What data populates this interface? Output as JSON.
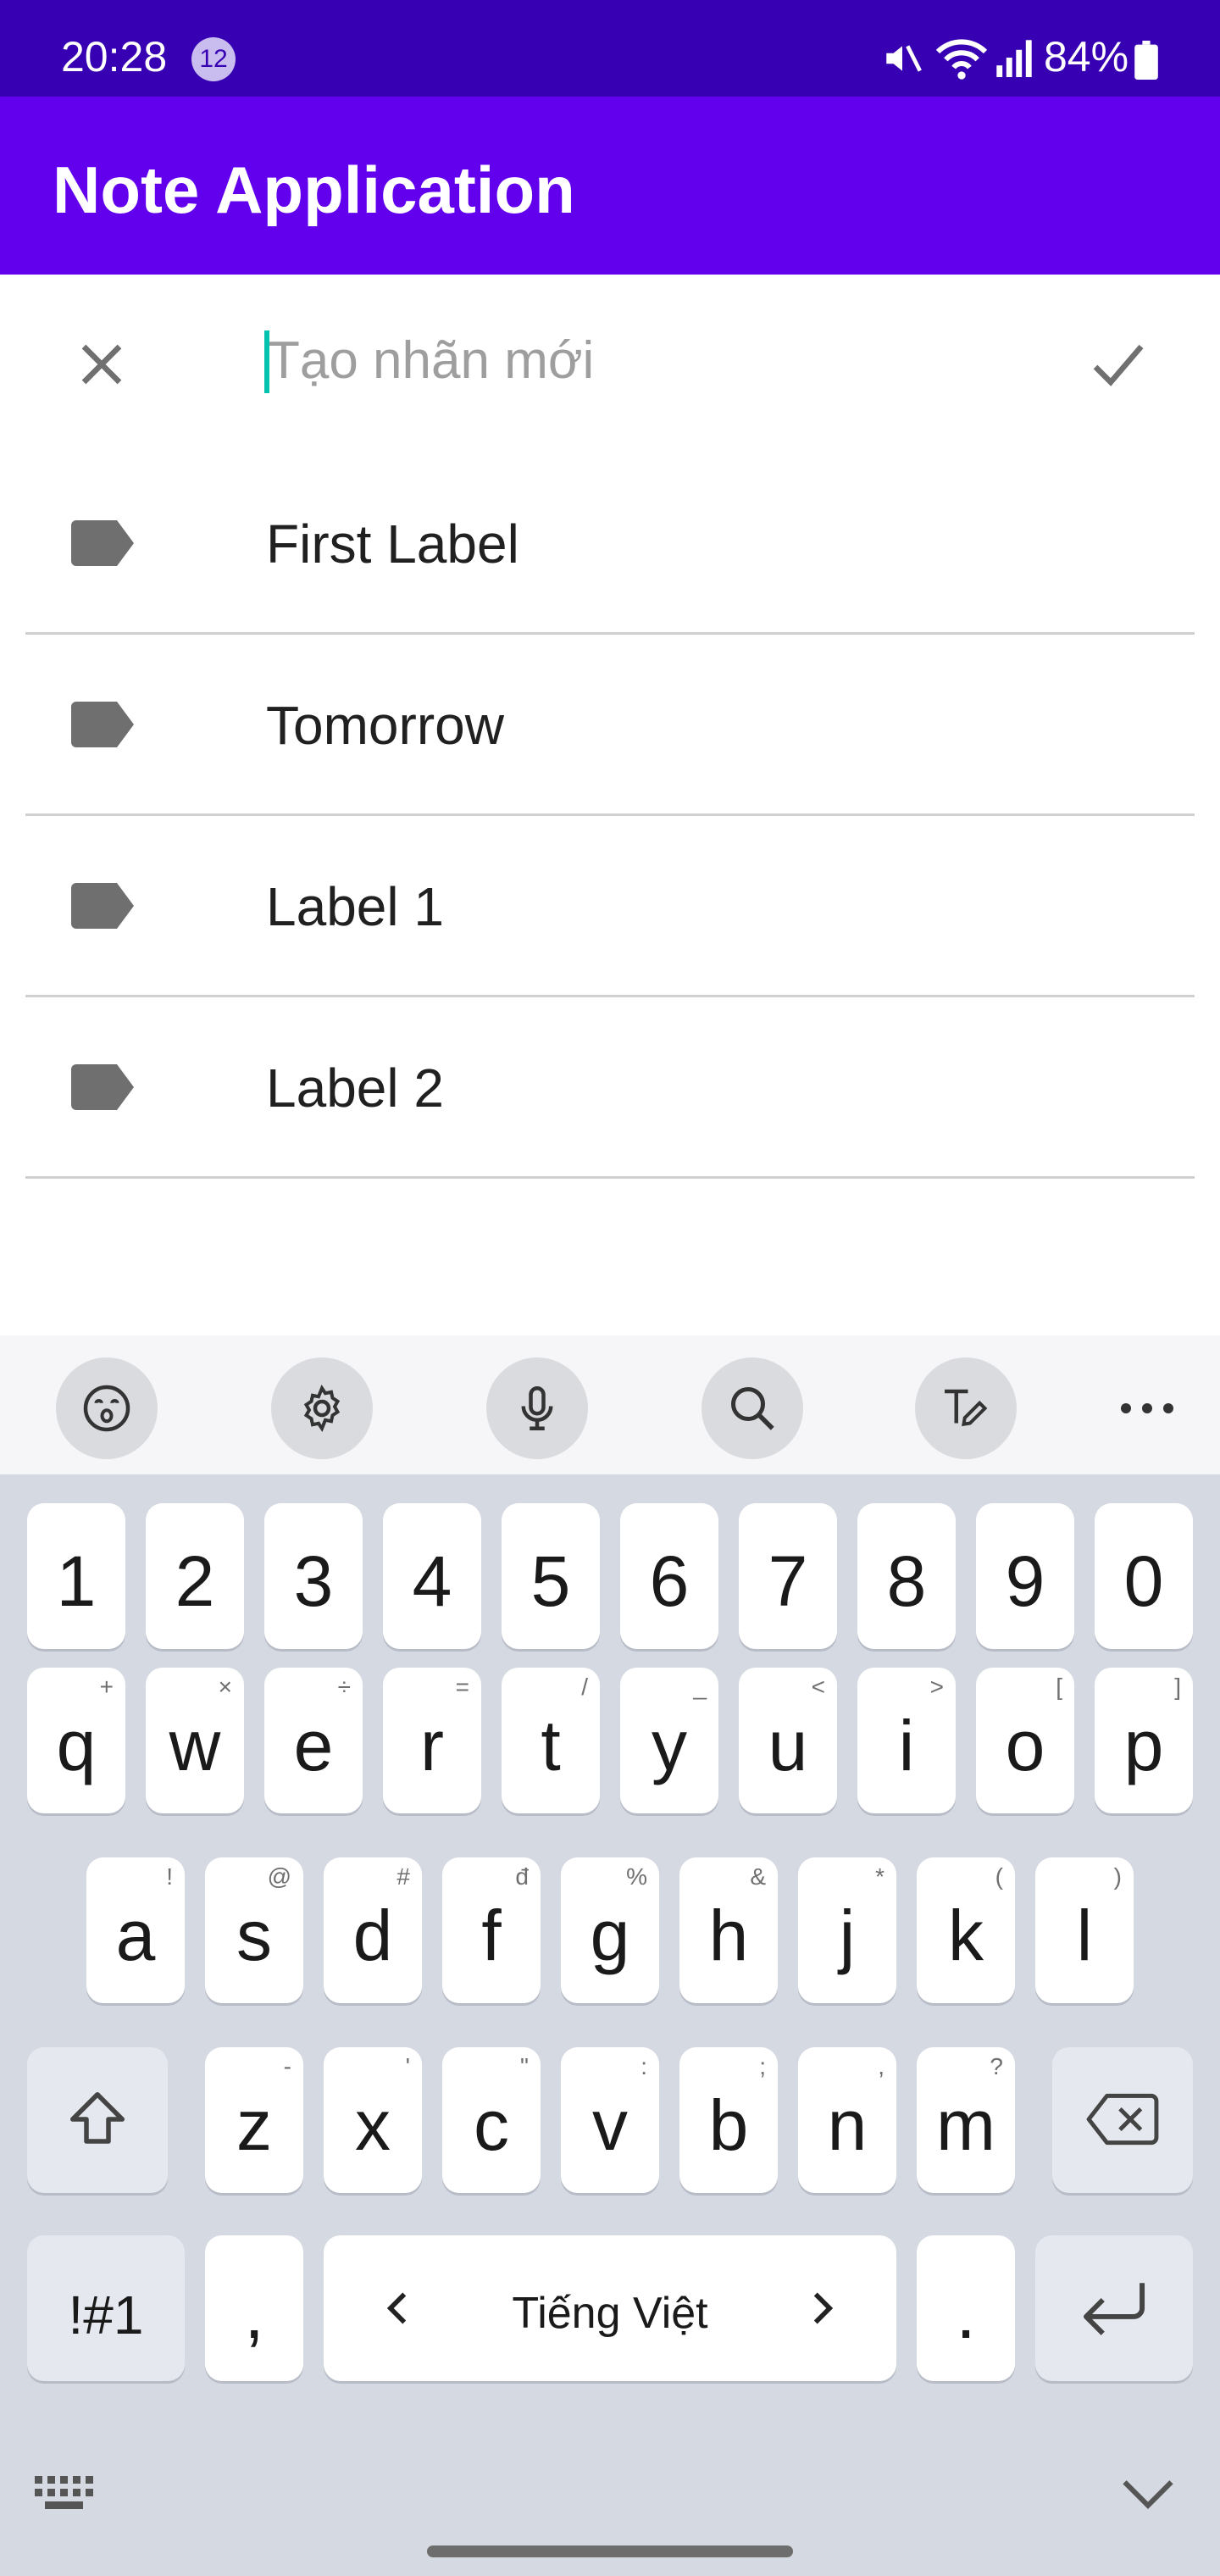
{
  "status_bar": {
    "time": "20:28",
    "notification_count": "12",
    "battery": "84%"
  },
  "app_bar": {
    "title": "Note Application"
  },
  "new_label": {
    "placeholder": "Tạo nhãn mới",
    "value": ""
  },
  "labels": [
    {
      "name": "First Label"
    },
    {
      "name": "Tomorrow"
    },
    {
      "name": "Label 1"
    },
    {
      "name": "Label 2"
    }
  ],
  "keyboard": {
    "toolbar": [
      "emoji-icon",
      "settings-icon",
      "microphone-icon",
      "search-icon",
      "handwriting-icon",
      "more-icon"
    ],
    "number_row": [
      "1",
      "2",
      "3",
      "4",
      "5",
      "6",
      "7",
      "8",
      "9",
      "0"
    ],
    "row1": [
      {
        "key": "q",
        "alt": "+"
      },
      {
        "key": "w",
        "alt": "×"
      },
      {
        "key": "e",
        "alt": "÷"
      },
      {
        "key": "r",
        "alt": "="
      },
      {
        "key": "t",
        "alt": "/"
      },
      {
        "key": "y",
        "alt": "_"
      },
      {
        "key": "u",
        "alt": "<"
      },
      {
        "key": "i",
        "alt": ">"
      },
      {
        "key": "o",
        "alt": "["
      },
      {
        "key": "p",
        "alt": "]"
      }
    ],
    "row2": [
      {
        "key": "a",
        "alt": "!"
      },
      {
        "key": "s",
        "alt": "@"
      },
      {
        "key": "d",
        "alt": "#"
      },
      {
        "key": "f",
        "alt": "đ"
      },
      {
        "key": "g",
        "alt": "%"
      },
      {
        "key": "h",
        "alt": "&"
      },
      {
        "key": "j",
        "alt": "*"
      },
      {
        "key": "k",
        "alt": "("
      },
      {
        "key": "l",
        "alt": ")"
      }
    ],
    "row3": [
      {
        "key": "z",
        "alt": "-"
      },
      {
        "key": "x",
        "alt": "'"
      },
      {
        "key": "c",
        "alt": "\""
      },
      {
        "key": "v",
        "alt": ":"
      },
      {
        "key": "b",
        "alt": ";"
      },
      {
        "key": "n",
        "alt": ","
      },
      {
        "key": "m",
        "alt": "?"
      }
    ],
    "symbols_key": "!#1",
    "comma_key": ",",
    "space_label": "Tiếng Việt",
    "period_key": ".",
    "colors": {
      "keyboard_bg": "#d5d9e2",
      "key_bg": "#ffffff"
    }
  },
  "colors": {
    "status_bar": "#3700b3",
    "app_bar": "#6200ee",
    "cursor": "#03c2b0"
  }
}
